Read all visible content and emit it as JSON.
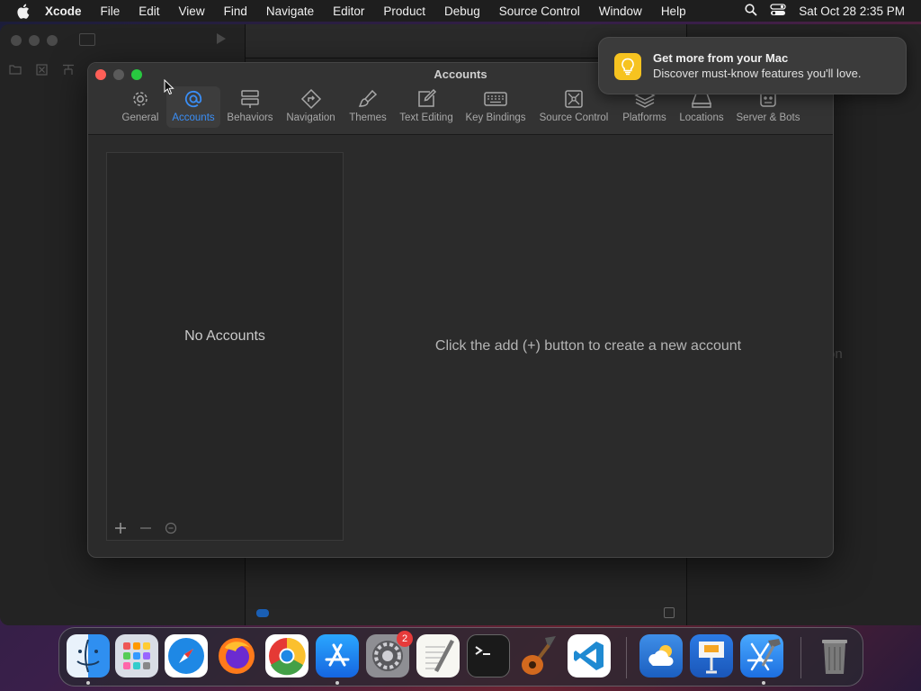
{
  "menubar": {
    "app": "Xcode",
    "items": [
      "File",
      "Edit",
      "View",
      "Find",
      "Navigate",
      "Editor",
      "Product",
      "Debug",
      "Source Control",
      "Window",
      "Help"
    ],
    "clock": "Sat Oct 28  2:35 PM"
  },
  "window": {
    "title": "Accounts",
    "tabs": [
      {
        "label": "General",
        "icon": "gear-icon"
      },
      {
        "label": "Accounts",
        "icon": "at-icon",
        "active": true
      },
      {
        "label": "Behaviors",
        "icon": "behaviors-icon"
      },
      {
        "label": "Navigation",
        "icon": "navigation-icon"
      },
      {
        "label": "Themes",
        "icon": "brush-icon"
      },
      {
        "label": "Text Editing",
        "icon": "edit-icon"
      },
      {
        "label": "Key Bindings",
        "icon": "keyboard-icon"
      },
      {
        "label": "Source Control",
        "icon": "source-control-icon"
      },
      {
        "label": "Platforms",
        "icon": "stack-icon"
      },
      {
        "label": "Locations",
        "icon": "drive-icon"
      },
      {
        "label": "Server & Bots",
        "icon": "server-icon"
      }
    ],
    "empty_list": "No Accounts",
    "hint": "Click the add (+) button to create a new account",
    "accent": "#3a8ef6"
  },
  "background": {
    "partial_text": "on"
  },
  "notification": {
    "title": "Get more from your Mac",
    "body": "Discover must-know features you'll love.",
    "icon": "lightbulb-icon"
  },
  "dock": {
    "apps": [
      {
        "name": "Finder",
        "icon": "finder-icon"
      },
      {
        "name": "Launchpad",
        "icon": "launchpad-icon"
      },
      {
        "name": "Safari",
        "icon": "safari-icon"
      },
      {
        "name": "Firefox",
        "icon": "firefox-icon"
      },
      {
        "name": "Chrome",
        "icon": "chrome-icon"
      },
      {
        "name": "App Store",
        "icon": "app-store-icon"
      },
      {
        "name": "System Settings",
        "icon": "settings-icon",
        "badge": "2"
      },
      {
        "name": "TextEdit",
        "icon": "textedit-icon"
      },
      {
        "name": "Terminal",
        "icon": "terminal-icon"
      },
      {
        "name": "GarageBand",
        "icon": "guitar-icon"
      },
      {
        "name": "VS Code",
        "icon": "vscode-icon"
      },
      {
        "name": "Weather",
        "icon": "weather-icon"
      },
      {
        "name": "Keynote",
        "icon": "keynote-icon"
      },
      {
        "name": "Xcode",
        "icon": "xcode-icon"
      },
      {
        "name": "Trash",
        "icon": "trash-icon"
      }
    ]
  }
}
